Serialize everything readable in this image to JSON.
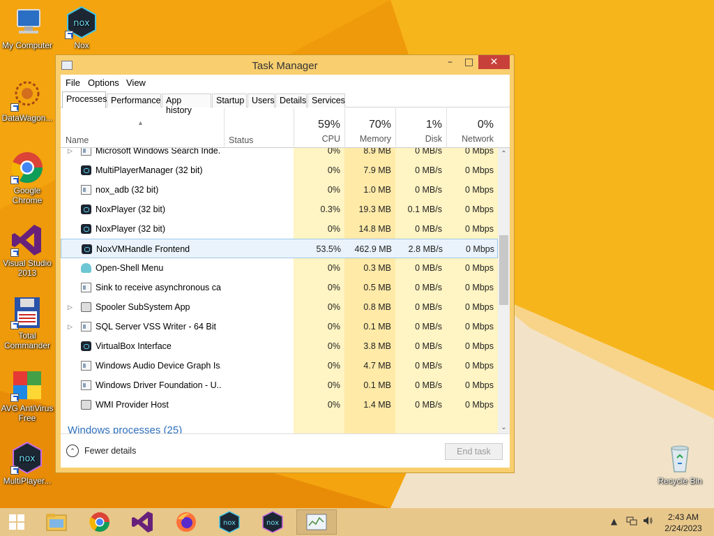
{
  "desktop": {
    "icons": [
      {
        "label": "My Computer",
        "icon": "computer-icon"
      },
      {
        "label": "Nox",
        "icon": "nox-icon"
      },
      {
        "label": "DataWagon...",
        "icon": "datawagon-icon"
      },
      {
        "label": "Google Chrome",
        "icon": "chrome-icon"
      },
      {
        "label": "Visual Studio 2013",
        "icon": "visual-studio-icon"
      },
      {
        "label": "Total Commander",
        "icon": "total-commander-icon"
      },
      {
        "label": "AVG AntiVirus Free",
        "icon": "avg-icon"
      },
      {
        "label": "MultiPlayer...",
        "icon": "nox-multiplayer-icon"
      },
      {
        "label": "Recycle Bin",
        "icon": "recycle-bin-icon"
      }
    ]
  },
  "window": {
    "title": "Task Manager",
    "minimize": "–",
    "maximize": "□",
    "close": "✕"
  },
  "menu": [
    "File",
    "Options",
    "View"
  ],
  "tabs": [
    "Processes",
    "Performance",
    "App history",
    "Startup",
    "Users",
    "Details",
    "Services"
  ],
  "active_tab": "Processes",
  "columns": {
    "name": "Name",
    "status": "Status",
    "cpu": {
      "pct": "59%",
      "label": "CPU"
    },
    "memory": {
      "pct": "70%",
      "label": "Memory"
    },
    "disk": {
      "pct": "1%",
      "label": "Disk"
    },
    "network": {
      "pct": "0%",
      "label": "Network"
    }
  },
  "processes": [
    {
      "name": "Microsoft Windows Search Inde...",
      "icon": "window-icon",
      "expandable": true,
      "cpu": "0%",
      "mem": "8.9 MB",
      "disk": "0 MB/s",
      "net": "0 Mbps"
    },
    {
      "name": "MultiPlayerManager (32 bit)",
      "icon": "nox-icon",
      "expandable": false,
      "cpu": "0%",
      "mem": "7.9 MB",
      "disk": "0 MB/s",
      "net": "0 Mbps"
    },
    {
      "name": "nox_adb (32 bit)",
      "icon": "window-icon",
      "expandable": false,
      "cpu": "0%",
      "mem": "1.0 MB",
      "disk": "0 MB/s",
      "net": "0 Mbps"
    },
    {
      "name": "NoxPlayer (32 bit)",
      "icon": "nox-icon",
      "expandable": false,
      "cpu": "0.3%",
      "mem": "19.3 MB",
      "disk": "0.1 MB/s",
      "net": "0 Mbps"
    },
    {
      "name": "NoxPlayer (32 bit)",
      "icon": "nox-icon",
      "expandable": false,
      "cpu": "0%",
      "mem": "14.8 MB",
      "disk": "0 MB/s",
      "net": "0 Mbps"
    },
    {
      "name": "NoxVMHandle Frontend",
      "icon": "nox-icon",
      "expandable": false,
      "cpu": "53.5%",
      "mem": "462.9 MB",
      "disk": "2.8 MB/s",
      "net": "0 Mbps",
      "selected": true
    },
    {
      "name": "Open-Shell Menu",
      "icon": "shell-icon",
      "expandable": false,
      "cpu": "0%",
      "mem": "0.3 MB",
      "disk": "0 MB/s",
      "net": "0 Mbps"
    },
    {
      "name": "Sink to receive asynchronous ca...",
      "icon": "window-icon",
      "expandable": false,
      "cpu": "0%",
      "mem": "0.5 MB",
      "disk": "0 MB/s",
      "net": "0 Mbps"
    },
    {
      "name": "Spooler SubSystem App",
      "icon": "printer-icon",
      "expandable": true,
      "cpu": "0%",
      "mem": "0.8 MB",
      "disk": "0 MB/s",
      "net": "0 Mbps"
    },
    {
      "name": "SQL Server VSS Writer - 64 Bit",
      "icon": "window-icon",
      "expandable": true,
      "cpu": "0%",
      "mem": "0.1 MB",
      "disk": "0 MB/s",
      "net": "0 Mbps"
    },
    {
      "name": "VirtualBox Interface",
      "icon": "nox-icon",
      "expandable": false,
      "cpu": "0%",
      "mem": "3.8 MB",
      "disk": "0 MB/s",
      "net": "0 Mbps"
    },
    {
      "name": "Windows Audio Device Graph Is...",
      "icon": "window-icon",
      "expandable": false,
      "cpu": "0%",
      "mem": "4.7 MB",
      "disk": "0 MB/s",
      "net": "0 Mbps"
    },
    {
      "name": "Windows Driver Foundation - U...",
      "icon": "window-icon",
      "expandable": false,
      "cpu": "0%",
      "mem": "0.1 MB",
      "disk": "0 MB/s",
      "net": "0 Mbps"
    },
    {
      "name": "WMI Provider Host",
      "icon": "printer-icon",
      "expandable": false,
      "cpu": "0%",
      "mem": "1.4 MB",
      "disk": "0 MB/s",
      "net": "0 Mbps"
    }
  ],
  "group_header": "Windows processes (25)",
  "footer": {
    "fewer_details": "Fewer details",
    "end_task": "End task"
  },
  "taskbar": {
    "items": [
      "start-icon",
      "file-explorer-icon",
      "chrome-icon",
      "visual-studio-icon",
      "firefox-icon",
      "nox-icon",
      "nox-multiplayer-icon",
      "task-manager-icon"
    ],
    "time": "2:43 AM",
    "date": "2/24/2023"
  }
}
